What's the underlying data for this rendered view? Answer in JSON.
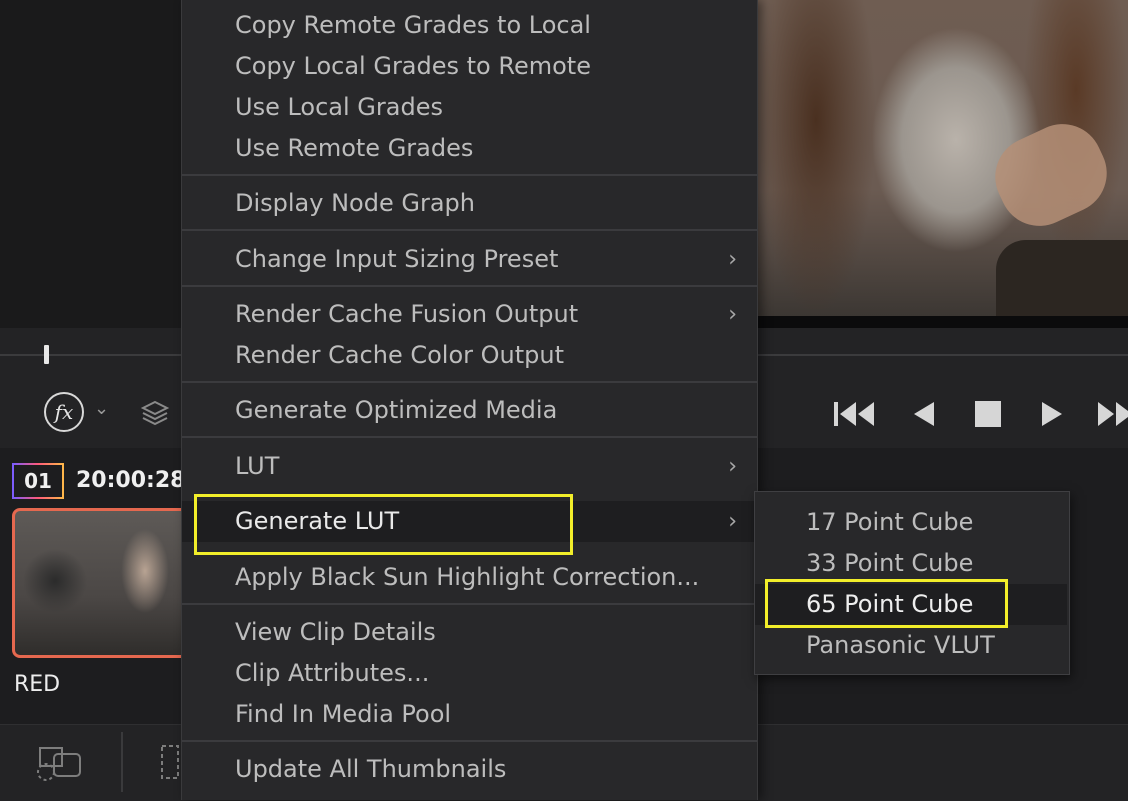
{
  "menu": {
    "items": [
      {
        "label": "Copy Remote Grades to Local"
      },
      {
        "label": "Copy Local Grades to Remote"
      },
      {
        "label": "Use Local Grades"
      },
      {
        "label": "Use Remote Grades"
      },
      {
        "label": "Display Node Graph"
      },
      {
        "label": "Change Input Sizing Preset",
        "submenu_arrow": "›"
      },
      {
        "label": "Render Cache Fusion Output",
        "submenu_arrow": "›"
      },
      {
        "label": "Render Cache Color Output"
      },
      {
        "label": "Generate Optimized Media"
      },
      {
        "label": "LUT",
        "submenu_arrow": "›"
      },
      {
        "label": "Generate LUT",
        "submenu_arrow": "›",
        "state": "highlighted"
      },
      {
        "label": "Apply Black Sun Highlight Correction..."
      },
      {
        "label": "View Clip Details"
      },
      {
        "label": "Clip Attributes..."
      },
      {
        "label": "Find In Media Pool"
      },
      {
        "label": "Update All Thumbnails"
      }
    ]
  },
  "submenu": {
    "items": [
      {
        "label": "17 Point Cube"
      },
      {
        "label": "33 Point Cube"
      },
      {
        "label": "65 Point Cube",
        "state": "highlighted"
      },
      {
        "label": "Panasonic VLUT"
      }
    ]
  },
  "clip": {
    "number": "01",
    "timecode": "20:00:28",
    "name": "RED"
  },
  "toolbar": {
    "fx_label": "fx",
    "fx_chevron": "⌄"
  },
  "colors": {
    "highlight_box": "#f2ee2a",
    "clip_border": "#e5684f",
    "menu_bg": "#28282a"
  }
}
